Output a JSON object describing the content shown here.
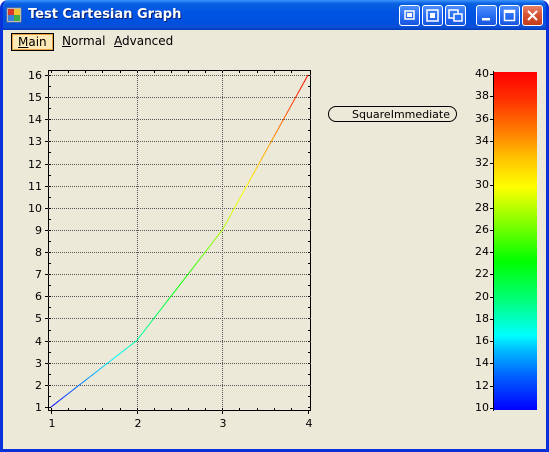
{
  "window": {
    "title": "Test Cartesian Graph"
  },
  "titlebar_buttons": [
    {
      "name": "restore-icon-button"
    },
    {
      "name": "maximize-alt-button"
    },
    {
      "name": "tile-button"
    },
    {
      "name": "minimize-button"
    },
    {
      "name": "maximize-button"
    },
    {
      "name": "close-button"
    }
  ],
  "menu": {
    "items": [
      {
        "label": "Main",
        "accel": "M",
        "rest": "ain",
        "selected": true
      },
      {
        "label": "Normal",
        "accel": "N",
        "rest": "ormal",
        "selected": false
      },
      {
        "label": "Advanced",
        "accel": "A",
        "rest": "dvanced",
        "selected": false
      }
    ]
  },
  "legend": {
    "label": "SquareImmediate"
  },
  "colorbar": {
    "min": 10,
    "max": 40,
    "ticks": [
      "10",
      "12",
      "14",
      "16",
      "18",
      "20",
      "22",
      "24",
      "26",
      "28",
      "30",
      "32",
      "34",
      "36",
      "38",
      "40"
    ],
    "colors": [
      "#0000ff",
      "#00ffff",
      "#00ff00",
      "#ffff00",
      "#ff0000"
    ]
  },
  "chart_data": {
    "type": "line",
    "title": "",
    "xlabel": "",
    "ylabel": "",
    "x": [
      1,
      2,
      3,
      4
    ],
    "series": [
      {
        "name": "SquareImmediate",
        "values": [
          1,
          4,
          9,
          16
        ]
      }
    ],
    "xlim": [
      1,
      4
    ],
    "ylim": [
      1,
      16
    ],
    "x_ticks": [
      "1",
      "2",
      "3",
      "4"
    ],
    "y_ticks": [
      "1",
      "2",
      "3",
      "4",
      "5",
      "6",
      "7",
      "8",
      "9",
      "10",
      "11",
      "12",
      "13",
      "14",
      "15",
      "16"
    ],
    "grid": true,
    "color_by_value": true,
    "color_scale": {
      "min": 10,
      "max": 40
    }
  }
}
